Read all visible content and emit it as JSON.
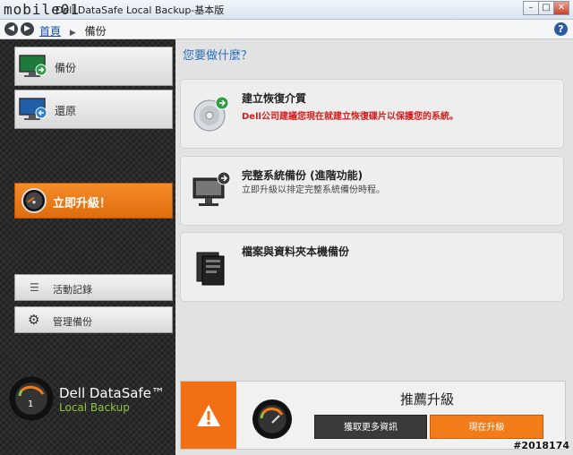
{
  "window": {
    "watermark": "mobile01",
    "title": "Dell DataSafe Local Backup-基本版",
    "minimize": "–",
    "maximize": "□",
    "close": "✕"
  },
  "nav": {
    "home": "首頁",
    "current": "備份",
    "help": "?"
  },
  "sidebar": {
    "items": [
      {
        "label": "備份",
        "icon": "monitor-arrow-icon"
      },
      {
        "label": "還原",
        "icon": "monitor-restore-icon"
      }
    ],
    "upgrade": {
      "label": "立即升級！"
    },
    "secondary": [
      {
        "label": "活動記錄",
        "icon": "list-icon"
      },
      {
        "label": "管理備份",
        "icon": "gear-icon"
      }
    ],
    "logo": {
      "title": "Dell DataSafe™",
      "subtitle": "Local Backup"
    }
  },
  "main": {
    "question": "您要做什麼？",
    "cards": [
      {
        "title": "建立恢復介質",
        "desc": "Dell公司建議您現在就建立恢復碟片以保護您的系統。",
        "icon": "disc-icon"
      },
      {
        "title": "完整系統備份 (進階功能)",
        "desc": "立即升級以排定完整系統備份時程。",
        "icon": "computer-icon"
      },
      {
        "title": "檔案與資料夾本機備份",
        "desc": "",
        "icon": "files-icon"
      }
    ],
    "recommend": {
      "title": "推薦升級",
      "more_label": "獲取更多資訊",
      "upgrade_label": "現在升級"
    }
  },
  "tag": "#2018174",
  "colors": {
    "accent": "#f27b1a",
    "link": "#2a6fc0",
    "sidebar": "#2a2a2a"
  }
}
